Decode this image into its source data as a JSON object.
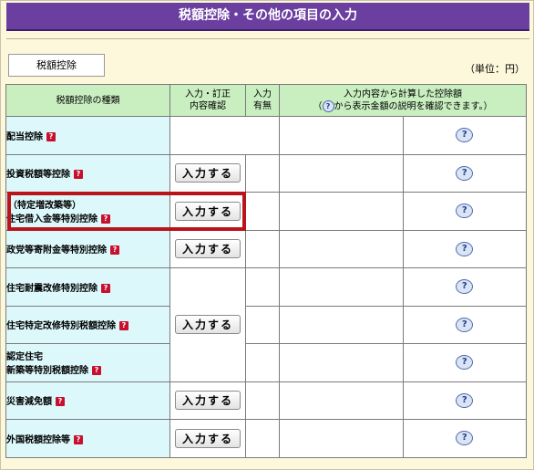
{
  "page": {
    "title": "税額控除・その他の項目の入力"
  },
  "tab": {
    "label": "税額控除"
  },
  "unit_label": "（単位：円）",
  "headers": {
    "type": "税額控除の種類",
    "input_line1": "入力・訂正",
    "input_line2": "内容確認",
    "flag_line1": "入力",
    "flag_line2": "有無",
    "amount_line1": "入力内容から計算した控除額",
    "amount_line2_pre": "（",
    "amount_line2_post": "から表示金額の説明を確認できます。）"
  },
  "button_label": "入力する",
  "rows": [
    {
      "name": "配当控除"
    },
    {
      "name": "投資税額等控除"
    },
    {
      "name_line1": "（特定増改築等）",
      "name_line2": "住宅借入金等特別控除"
    },
    {
      "name": "政党等寄附金等特別控除"
    },
    {
      "name": "住宅耐震改修特別控除"
    },
    {
      "name": "住宅特定改修特別税額控除"
    },
    {
      "name_line1": "認定住宅",
      "name_line2": "新築等特別税額控除"
    },
    {
      "name": "災害減免額"
    },
    {
      "name": "外国税額控除等"
    }
  ],
  "icons": {
    "question": "?",
    "help": "?"
  }
}
